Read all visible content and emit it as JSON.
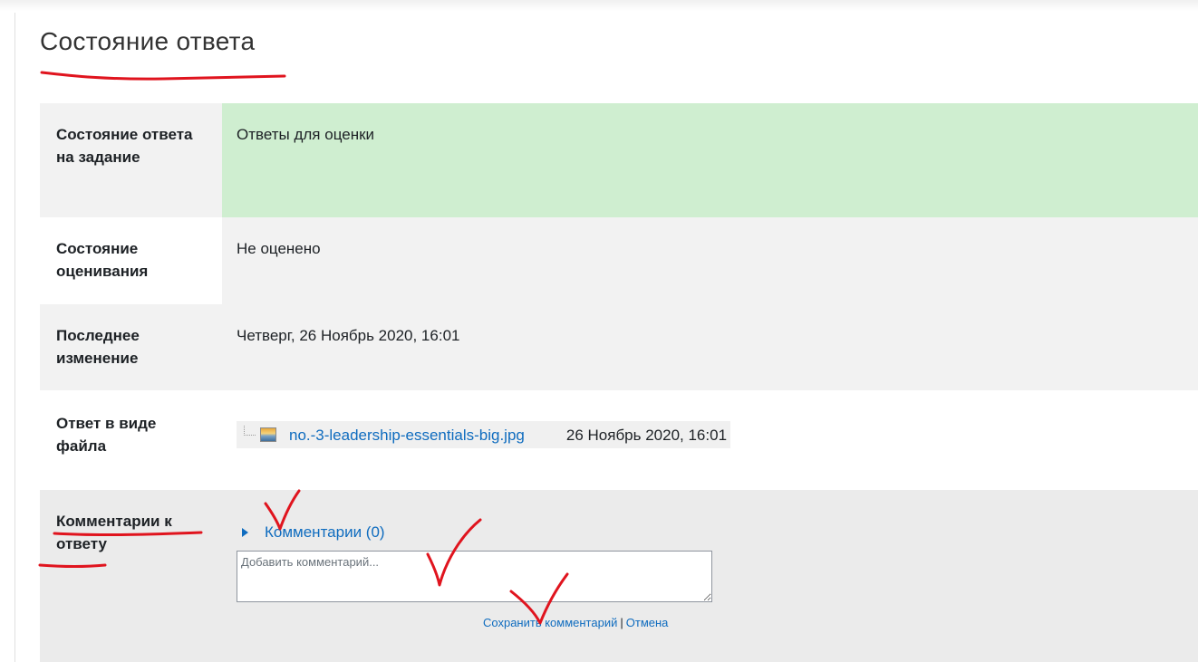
{
  "section": {
    "title": "Состояние ответа"
  },
  "rows": [
    {
      "label": "Состояние ответа на задание",
      "value": "Ответы для оценки"
    },
    {
      "label": "Состояние оценивания",
      "value": "Не оценено"
    },
    {
      "label": "Последнее изменение",
      "value": "Четверг, 26 Ноябрь 2020, 16:01"
    },
    {
      "label": "Ответ в виде файла",
      "file_name": "no.-3-leadership-essentials-big.jpg",
      "file_date": "26 Ноябрь 2020, 16:01"
    },
    {
      "label": "Комментарии к ответу"
    }
  ],
  "comments": {
    "toggle_label": "Комментарии (0)",
    "placeholder": "Добавить комментарий...",
    "save_label": "Сохранить комментарий",
    "separator": "|",
    "cancel_label": "Отмена"
  },
  "colors": {
    "submitted_bg": "#cfeed0",
    "link": "#0f6cbf",
    "annotation": "#e0141e"
  },
  "icons": [
    "tree-line-icon",
    "image-file-icon",
    "caret-right-icon"
  ]
}
